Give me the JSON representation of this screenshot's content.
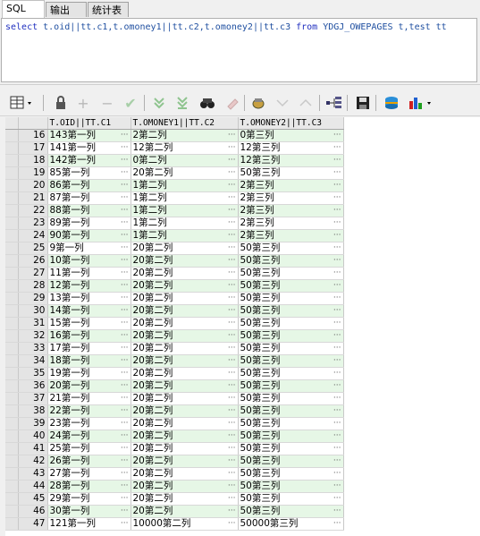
{
  "tabs": [
    "SQL",
    "输出",
    "统计表"
  ],
  "sql": {
    "select_kw": "select",
    "part1": " t.oid||tt.c1,t.omoney1||tt.c2,t.omoney2||tt.c3 ",
    "from_kw": "from",
    "part2": " YDGJ_OWEPAGES t,test tt"
  },
  "toolbar_icons": [
    "grid-icon",
    "lock-icon",
    "add-icon",
    "remove-icon",
    "check-icon",
    "fetch-next-icon",
    "fetch-all-icon",
    "find-icon",
    "clear-icon",
    "query-icon",
    "down-arrow-icon",
    "up-arrow-icon",
    "tree-icon",
    "save-icon",
    "export-icon",
    "chart-icon"
  ],
  "columns": [
    "T.OID||TT.C1",
    "T.OMONEY1||TT.C2",
    "T.OMONEY2||TT.C3"
  ],
  "rows": [
    {
      "n": "16",
      "c1": "143第一列",
      "c2": "2第二列",
      "c3": "0第三列"
    },
    {
      "n": "17",
      "c1": "141第一列",
      "c2": "12第二列",
      "c3": "12第三列"
    },
    {
      "n": "18",
      "c1": "142第一列",
      "c2": "0第二列",
      "c3": "12第三列"
    },
    {
      "n": "19",
      "c1": "85第一列",
      "c2": "20第二列",
      "c3": "50第三列"
    },
    {
      "n": "20",
      "c1": "86第一列",
      "c2": "1第二列",
      "c3": "2第三列"
    },
    {
      "n": "21",
      "c1": "87第一列",
      "c2": "1第二列",
      "c3": "2第三列"
    },
    {
      "n": "22",
      "c1": "88第一列",
      "c2": "1第二列",
      "c3": "2第三列"
    },
    {
      "n": "23",
      "c1": "89第一列",
      "c2": "1第二列",
      "c3": "2第三列"
    },
    {
      "n": "24",
      "c1": "90第一列",
      "c2": "1第二列",
      "c3": "2第三列"
    },
    {
      "n": "25",
      "c1": "9第一列",
      "c2": "20第二列",
      "c3": "50第三列"
    },
    {
      "n": "26",
      "c1": "10第一列",
      "c2": "20第二列",
      "c3": "50第三列"
    },
    {
      "n": "27",
      "c1": "11第一列",
      "c2": "20第二列",
      "c3": "50第三列"
    },
    {
      "n": "28",
      "c1": "12第一列",
      "c2": "20第二列",
      "c3": "50第三列"
    },
    {
      "n": "29",
      "c1": "13第一列",
      "c2": "20第二列",
      "c3": "50第三列"
    },
    {
      "n": "30",
      "c1": "14第一列",
      "c2": "20第二列",
      "c3": "50第三列"
    },
    {
      "n": "31",
      "c1": "15第一列",
      "c2": "20第二列",
      "c3": "50第三列"
    },
    {
      "n": "32",
      "c1": "16第一列",
      "c2": "20第二列",
      "c3": "50第三列"
    },
    {
      "n": "33",
      "c1": "17第一列",
      "c2": "20第二列",
      "c3": "50第三列"
    },
    {
      "n": "34",
      "c1": "18第一列",
      "c2": "20第二列",
      "c3": "50第三列"
    },
    {
      "n": "35",
      "c1": "19第一列",
      "c2": "20第二列",
      "c3": "50第三列"
    },
    {
      "n": "36",
      "c1": "20第一列",
      "c2": "20第二列",
      "c3": "50第三列"
    },
    {
      "n": "37",
      "c1": "21第一列",
      "c2": "20第二列",
      "c3": "50第三列"
    },
    {
      "n": "38",
      "c1": "22第一列",
      "c2": "20第二列",
      "c3": "50第三列"
    },
    {
      "n": "39",
      "c1": "23第一列",
      "c2": "20第二列",
      "c3": "50第三列"
    },
    {
      "n": "40",
      "c1": "24第一列",
      "c2": "20第二列",
      "c3": "50第三列"
    },
    {
      "n": "41",
      "c1": "25第一列",
      "c2": "20第二列",
      "c3": "50第三列"
    },
    {
      "n": "42",
      "c1": "26第一列",
      "c2": "20第二列",
      "c3": "50第三列"
    },
    {
      "n": "43",
      "c1": "27第一列",
      "c2": "20第二列",
      "c3": "50第三列"
    },
    {
      "n": "44",
      "c1": "28第一列",
      "c2": "20第二列",
      "c3": "50第三列"
    },
    {
      "n": "45",
      "c1": "29第一列",
      "c2": "20第二列",
      "c3": "50第三列"
    },
    {
      "n": "46",
      "c1": "30第一列",
      "c2": "20第二列",
      "c3": "50第三列"
    },
    {
      "n": "47",
      "c1": "121第一列",
      "c2": "10000第二列",
      "c3": "50000第三列"
    }
  ],
  "cell_more": "···",
  "colors": {
    "alt_row": "#e6f7e6",
    "keyword": "#1f2fbf"
  }
}
